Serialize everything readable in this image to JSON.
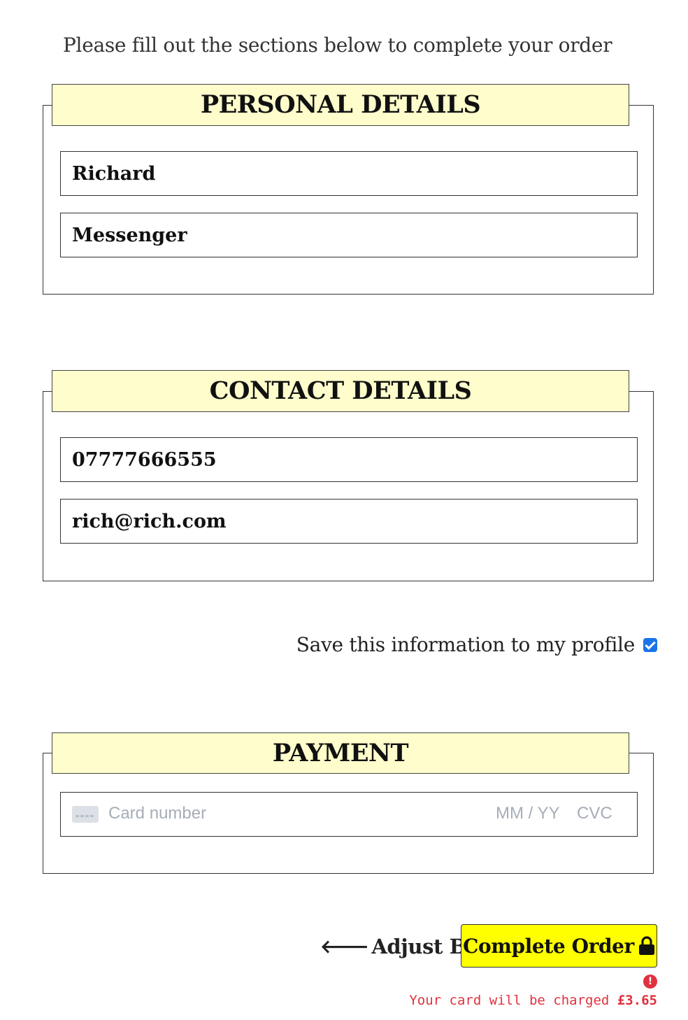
{
  "intro_text": "Please fill out the sections below to complete your order",
  "personal": {
    "legend": "PERSONAL DETAILS",
    "first_name_value": "Richard",
    "last_name_value": "Messenger"
  },
  "contact": {
    "legend": "CONTACT DETAILS",
    "phone_value": "07777666555",
    "email_value": "rich@rich.com"
  },
  "save_profile": {
    "label": "Save this information to my profile",
    "checked": true
  },
  "payment": {
    "legend": "PAYMENT",
    "card_number_placeholder": "Card number",
    "expiry_placeholder": "MM / YY",
    "cvc_placeholder": "CVC"
  },
  "actions": {
    "adjust_bag_label": "Adjust Bag",
    "complete_order_label": "Complete Order"
  },
  "charge": {
    "message": "Your card will be charged",
    "amount": "£3.65",
    "alert_symbol": "!"
  },
  "colors": {
    "legend_bg": "#fefdcb",
    "button_bg": "#ffff00",
    "error": "#e0313f",
    "checkbox": "#1a73e8"
  },
  "icons": [
    "credit-card-icon",
    "arrow-left-icon",
    "lock-icon",
    "alert-icon",
    "checkmark-icon"
  ]
}
